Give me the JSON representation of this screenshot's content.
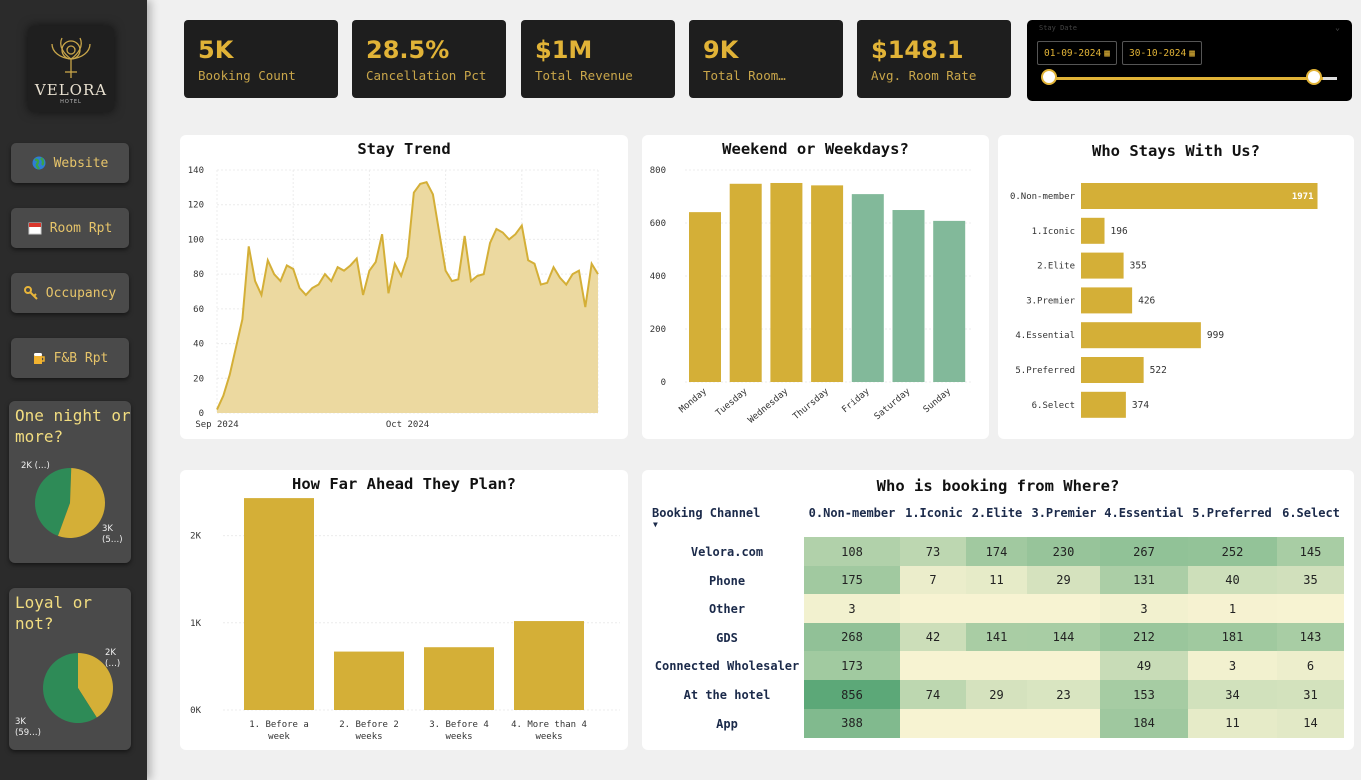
{
  "sidebar": {
    "logo": {
      "brand": "VELORA",
      "sub": "HOTEL"
    },
    "nav": [
      {
        "label": "Website",
        "icon": "globe-icon"
      },
      {
        "label": "Room Rpt",
        "icon": "calendar-icon"
      },
      {
        "label": "Occupancy",
        "icon": "key-icon"
      },
      {
        "label": "F&B Rpt",
        "icon": "beer-icon"
      }
    ],
    "night_card": {
      "title": "One night or more?",
      "labels": [
        "2K (…)",
        "3K (5…)"
      ],
      "values": [
        0.45,
        0.55
      ],
      "colors": [
        "#2e8b57",
        "#d4af37"
      ]
    },
    "loyal_card": {
      "title": "Loyal or not?",
      "labels": [
        "2K (…)",
        "3K (59…)"
      ],
      "values": [
        0.41,
        0.59
      ],
      "colors": [
        "#d4af37",
        "#2e8b57"
      ]
    }
  },
  "kpis": [
    {
      "value": "5K",
      "label": "Booking Count"
    },
    {
      "value": "28.5%",
      "label": "Cancellation Pct"
    },
    {
      "value": "$1M",
      "label": "Total Revenue"
    },
    {
      "value": "9K",
      "label": "Total Room…"
    },
    {
      "value": "$148.1",
      "label": "Avg. Room Rate"
    }
  ],
  "date_filter": {
    "title": "Stay Date",
    "start": "01-09-2024",
    "end": "30-10-2024",
    "range_fraction": [
      0,
      1
    ]
  },
  "colors": {
    "gold": "#d4af37",
    "green": "#82b99a",
    "fill": "#ecd9a0"
  },
  "chart_data": [
    {
      "type": "area",
      "title": "Stay Trend",
      "x_ticks": [
        "Sep 2024",
        "Oct 2024"
      ],
      "y_ticks": [
        0,
        20,
        40,
        60,
        80,
        100,
        120,
        140
      ],
      "ylim": [
        0,
        140
      ],
      "x_start": "2024-09-01",
      "x_tick_index": [
        0,
        30
      ],
      "values": [
        2,
        10,
        22,
        38,
        54,
        96,
        76,
        68,
        88,
        80,
        76,
        85,
        83,
        72,
        68,
        72,
        74,
        80,
        76,
        84,
        82,
        85,
        89,
        68,
        82,
        87,
        103,
        69,
        86,
        79,
        90,
        127,
        132,
        133,
        126,
        104,
        82,
        76,
        77,
        102,
        76,
        79,
        80,
        98,
        106,
        104,
        100,
        103,
        108,
        88,
        86,
        74,
        75,
        84,
        78,
        74,
        80,
        82,
        61,
        86,
        80
      ]
    },
    {
      "type": "bar",
      "title": "Weekend or Weekdays?",
      "categories": [
        "Monday",
        "Tuesday",
        "Wednesday",
        "Thursday",
        "Friday",
        "Saturday",
        "Sunday"
      ],
      "values": [
        641,
        748,
        751,
        742,
        709,
        649,
        608
      ],
      "weekend": [
        false,
        false,
        false,
        false,
        true,
        true,
        true
      ],
      "y_ticks": [
        0,
        200,
        400,
        600,
        800
      ],
      "ylim": [
        0,
        800
      ]
    },
    {
      "type": "bar",
      "orientation": "horizontal",
      "title": "Who Stays With Us?",
      "categories": [
        "0.Non-member",
        "1.Iconic",
        "2.Elite",
        "3.Premier",
        "4.Essential",
        "5.Preferred",
        "6.Select"
      ],
      "values": [
        1971,
        196,
        355,
        426,
        999,
        522,
        374
      ],
      "xlim": [
        0,
        2000
      ]
    },
    {
      "type": "bar",
      "title": "How Far Ahead They Plan?",
      "categories": [
        "1. Before a week",
        "2. Before 2 weeks",
        "3. Before 4 weeks",
        "4. More than 4 weeks"
      ],
      "values": [
        2430,
        670,
        720,
        1020
      ],
      "y_ticks": [
        "0K",
        "1K",
        "2K"
      ],
      "ylim": [
        0,
        2500
      ]
    },
    {
      "type": "heatmap",
      "title": "Who is booking from Where?",
      "row_header": "Booking Channel",
      "columns": [
        "0.Non-member",
        "1.Iconic",
        "2.Elite",
        "3.Premier",
        "4.Essential",
        "5.Preferred",
        "6.Select"
      ],
      "rows": [
        "Velora.com",
        "Phone",
        "Other",
        "GDS",
        "Connected Wholesaler",
        "At the hotel",
        "App"
      ],
      "values": [
        [
          108,
          73,
          174,
          230,
          267,
          252,
          145
        ],
        [
          175,
          7,
          11,
          29,
          131,
          40,
          35
        ],
        [
          3,
          null,
          null,
          null,
          3,
          1,
          null
        ],
        [
          268,
          42,
          141,
          144,
          212,
          181,
          143
        ],
        [
          173,
          null,
          null,
          null,
          49,
          3,
          6
        ],
        [
          856,
          74,
          29,
          23,
          153,
          34,
          31
        ],
        [
          388,
          null,
          null,
          null,
          184,
          11,
          14
        ]
      ]
    }
  ]
}
